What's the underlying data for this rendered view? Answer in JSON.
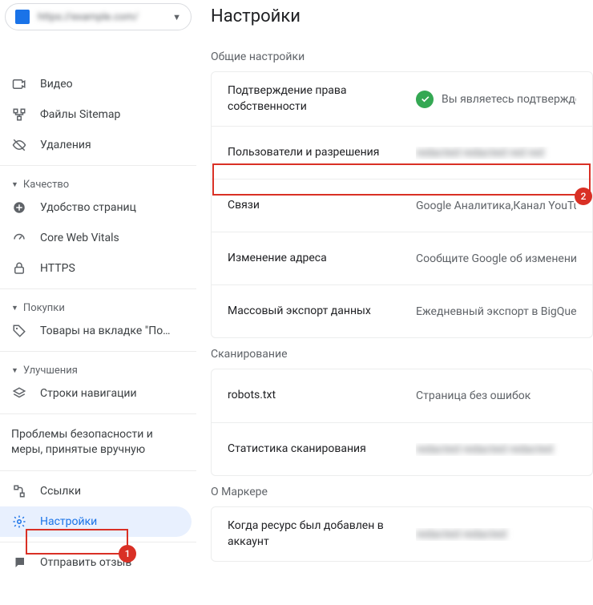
{
  "property_name": "https://example.com/",
  "page_title": "Настройки",
  "sidebar": {
    "items_top": [
      {
        "label": "",
        "icon": "blank"
      },
      {
        "label": "Видео",
        "icon": "video"
      },
      {
        "label": "Файлы Sitemap",
        "icon": "sitemap"
      },
      {
        "label": "Удаления",
        "icon": "visibility-off"
      }
    ],
    "section_quality": "Качество",
    "items_quality": [
      {
        "label": "Удобство страниц",
        "icon": "plus-circle"
      },
      {
        "label": "Core Web Vitals",
        "icon": "speed"
      },
      {
        "label": "HTTPS",
        "icon": "lock"
      }
    ],
    "section_shopping": "Покупки",
    "items_shopping": [
      {
        "label": "Товары на вкладке \"По…",
        "icon": "tag"
      }
    ],
    "section_enhance": "Улучшения",
    "items_enhance": [
      {
        "label": "Строки навигации",
        "icon": "layers"
      }
    ],
    "security_label": "Проблемы безопасности и меры, принятые вручную",
    "items_bottom": [
      {
        "label": "Ссылки",
        "icon": "links"
      },
      {
        "label": "Настройки",
        "icon": "gear",
        "active": true
      },
      {
        "label": "Отправить отзыв",
        "icon": "feedback"
      }
    ]
  },
  "sections": {
    "general": {
      "title": "Общие настройки",
      "rows": [
        {
          "label": "Подтверждение права собственности",
          "value": "Вы являетесь подтвержден",
          "verified": true
        },
        {
          "label": "Пользователи и разрешения",
          "value": "redacted redacted red red",
          "blurred": true
        },
        {
          "label": "Связи",
          "value": "Google Аналитика,Канал YouTube"
        },
        {
          "label": "Изменение адреса",
          "value": "Сообщите Google об изменении ад"
        },
        {
          "label": "Массовый экспорт данных",
          "value": "Ежедневный экспорт в BigQuery д"
        }
      ]
    },
    "crawling": {
      "title": "Сканирование",
      "rows": [
        {
          "label": "robots.txt",
          "value": "Страница без ошибок"
        },
        {
          "label": "Статистика сканирования",
          "value": "redacted redacted redacted",
          "blurred": true
        }
      ]
    },
    "about": {
      "title": "О Маркере",
      "rows": [
        {
          "label": "Когда ресурс был добавлен в аккаунт",
          "value": "redacted redacted",
          "blurred": true
        }
      ]
    }
  },
  "annotations": {
    "badge1": "1",
    "badge2": "2"
  }
}
